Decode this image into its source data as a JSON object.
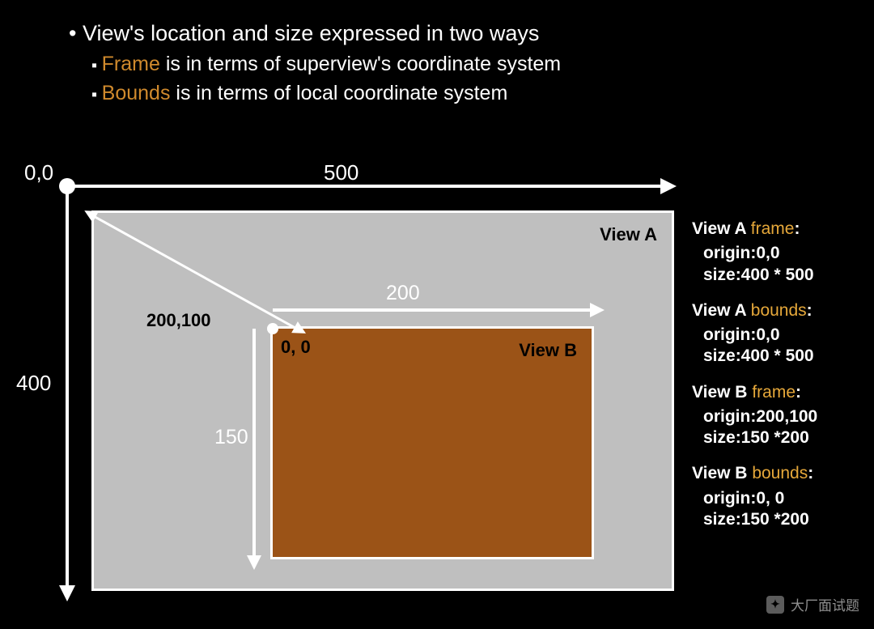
{
  "bullets": {
    "main": "View's location and size expressed in two ways",
    "sub1_pre": "Frame",
    "sub1_rest": " is in terms of superview's coordinate system",
    "sub2_pre": "Bounds",
    "sub2_rest": " is in terms of local coordinate system"
  },
  "axis": {
    "origin": "0,0",
    "x_label": "500",
    "y_label": "400"
  },
  "viewA": {
    "title": "View A",
    "diag_label": "200,100"
  },
  "viewB": {
    "title": "View B",
    "origin_label": "0, 0",
    "w_label": "200",
    "h_label": "150"
  },
  "info": {
    "a_frame_h": "View A ",
    "a_frame_k": "frame",
    "a_frame_colon": ":",
    "a_frame_origin": "origin:0,0",
    "a_frame_size": "size:400 * 500",
    "a_bounds_h": "View A ",
    "a_bounds_k": "bounds",
    "a_bounds_colon": ":",
    "a_bounds_origin": "origin:0,0",
    "a_bounds_size": "size:400 * 500",
    "b_frame_h": "View B ",
    "b_frame_k": "frame",
    "b_frame_colon": ":",
    "b_frame_origin": "origin:200,100",
    "b_frame_size": "size:150 *200",
    "b_bounds_h": "View B ",
    "b_bounds_k": "bounds",
    "b_bounds_colon": ":",
    "b_bounds_origin": "origin:0, 0",
    "b_bounds_size": "size:150 *200"
  },
  "watermark": "大厂面试题",
  "colors": {
    "accent": "#d08a2d",
    "viewB_fill": "#9b5317",
    "viewA_fill": "#bfbfbf"
  }
}
